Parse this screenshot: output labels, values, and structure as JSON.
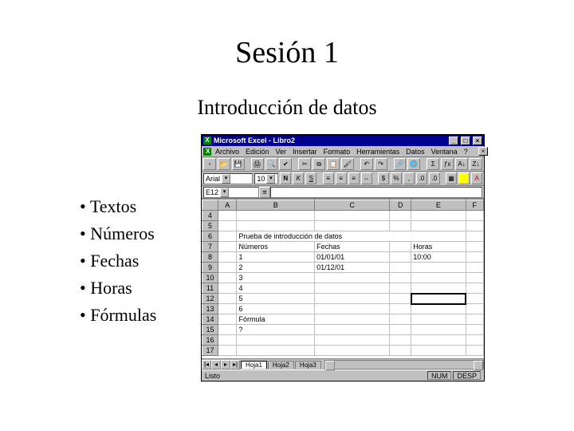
{
  "slide": {
    "title": "Sesión 1",
    "subtitle": "Introducción de datos",
    "bullets": [
      "Textos",
      "Números",
      "Fechas",
      "Horas",
      "Fórmulas"
    ]
  },
  "excel": {
    "app_title": "Microsoft Excel - Libro2",
    "menus": [
      "Archivo",
      "Edición",
      "Ver",
      "Insertar",
      "Formato",
      "Herramientas",
      "Datos",
      "Ventana",
      "?"
    ],
    "font_name": "Arial",
    "font_size": "10",
    "name_box": "E12",
    "formula_bar": "",
    "columns": [
      "A",
      "B",
      "C",
      "D",
      "E",
      "F"
    ],
    "row_start": 4,
    "row_end": 17,
    "cells": {
      "B6": "Prueba de introducción de datos",
      "B7": "Números",
      "C7": "Fechas",
      "E7": "Horas",
      "B8": "1",
      "C8": "01/01/01",
      "E8": "10:00",
      "B9": "2",
      "C9": "01/12/01",
      "B10": "3",
      "B11": "4",
      "B12": "5",
      "B13": "6",
      "B14": "Fórmula",
      "B15": "?"
    },
    "selected_cell": "E12",
    "sheet_tabs": [
      "Hoja1",
      "Hoja2",
      "Hoja3"
    ],
    "active_tab": 0,
    "status_left": "Listo",
    "status_flags": [
      "NUM",
      "DESP"
    ]
  }
}
